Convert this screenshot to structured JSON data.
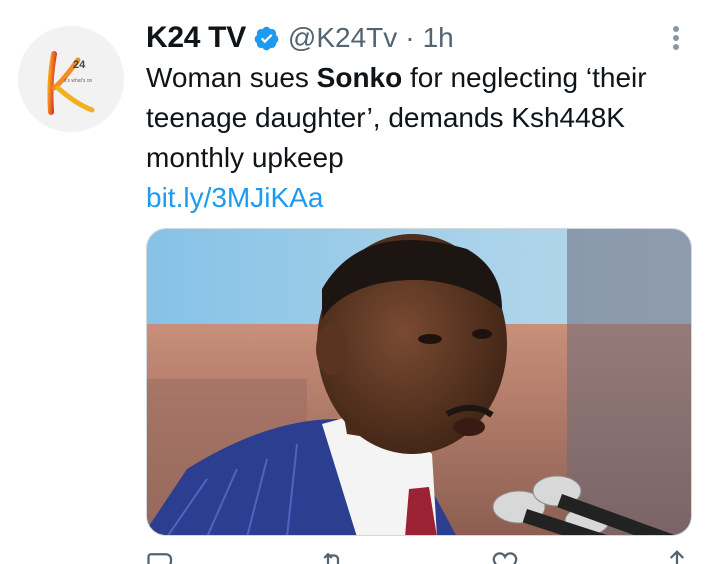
{
  "tweet": {
    "display_name": "K24 TV",
    "handle": "@K24Tv",
    "separator": "·",
    "time": "1h",
    "text_part1": "Woman sues ",
    "text_bold": "Sonko",
    "text_part2": " for neglecting ‘their teenage daughter’, demands Ksh448K monthly upkeep",
    "link": "bit.ly/3MJiKAa"
  },
  "avatar": {
    "logo_number": "24",
    "logo_tagline": "it's what's on"
  },
  "icons": {
    "verified": "verified-badge-icon",
    "more": "more-options-icon",
    "reply": "reply-icon",
    "retweet": "retweet-icon",
    "like": "like-icon",
    "share": "share-icon"
  },
  "colors": {
    "link": "#1d9bf0",
    "verified": "#1d9bf0",
    "secondary_text": "#536471",
    "logo_orange": "#f28c28",
    "logo_red": "#d7262e"
  }
}
